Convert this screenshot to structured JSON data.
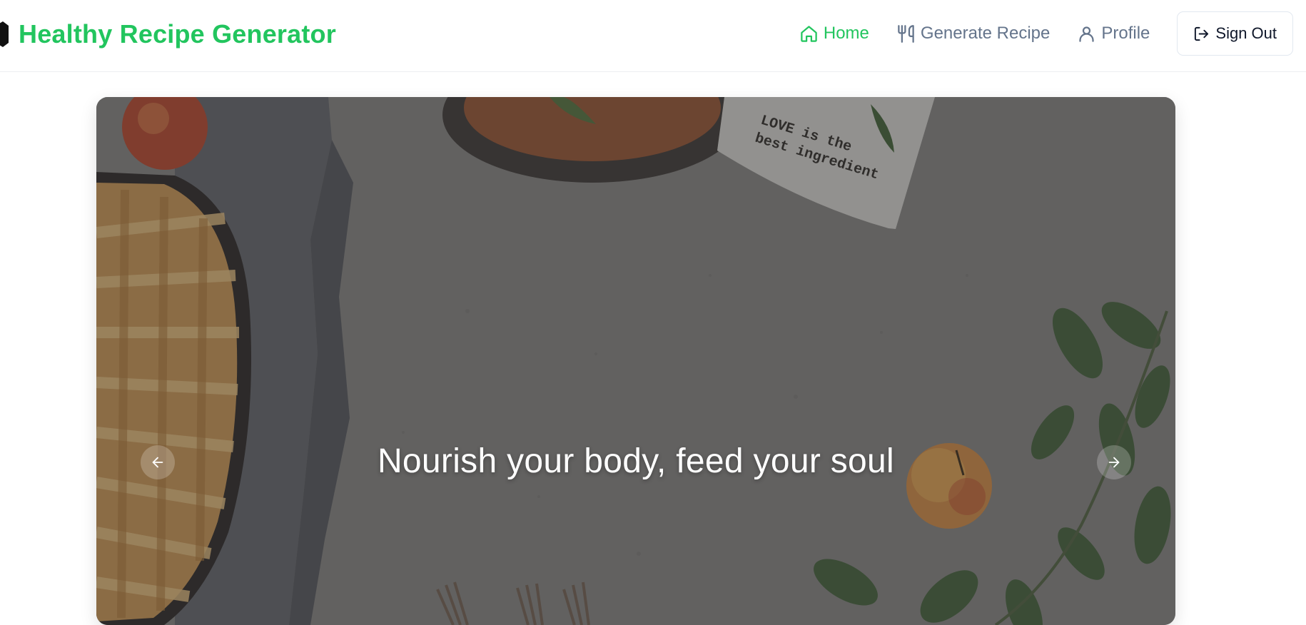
{
  "header": {
    "brand_title": "Healthy Recipe Generator",
    "brand_color": "#22c55e",
    "nav": {
      "home": "Home",
      "generate": "Generate Recipe",
      "profile": "Profile",
      "sign_out": "Sign Out"
    },
    "active_nav": "home",
    "icons": {
      "home": "home-icon",
      "generate": "utensils-icon",
      "profile": "user-icon",
      "sign_out": "log-out-icon"
    }
  },
  "hero": {
    "heading": "Nourish your body, feed your soul",
    "napkin_text": [
      "LOVE is the",
      "best ingredient"
    ],
    "prev_icon": "arrow-left-icon",
    "next_icon": "arrow-right-icon",
    "overlay_color": "#141418"
  }
}
